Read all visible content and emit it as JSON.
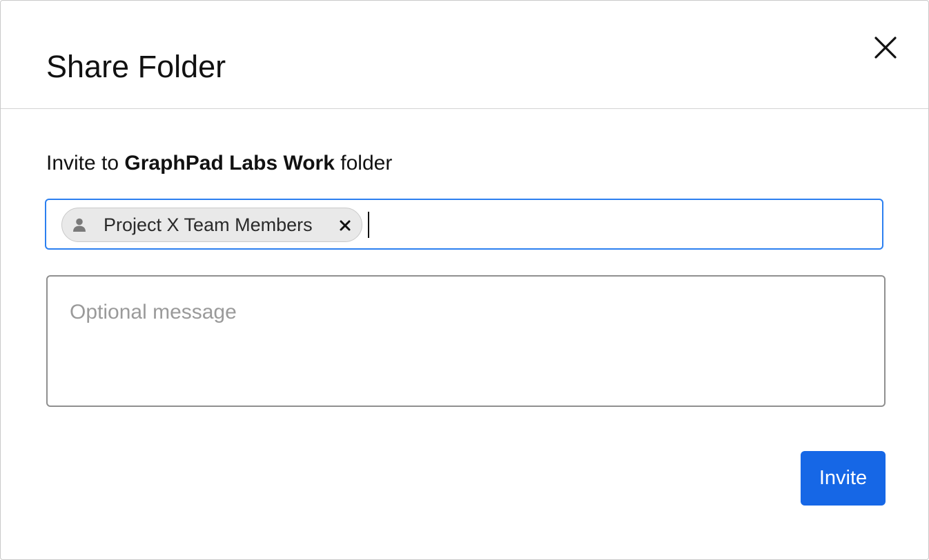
{
  "dialog": {
    "title": "Share Folder",
    "close_icon": "close-icon"
  },
  "invite": {
    "prefix": "Invite to",
    "folder_name": "GraphPad Labs Work",
    "suffix": "folder"
  },
  "recipients": {
    "chips": [
      {
        "label": "Project X Team Members",
        "icon": "person-icon",
        "remove_icon": "remove-icon"
      }
    ]
  },
  "message": {
    "placeholder": "Optional message",
    "value": ""
  },
  "actions": {
    "invite_label": "Invite"
  },
  "colors": {
    "accent": "#1667e6",
    "focus_border": "#2b7ff0",
    "chip_background": "#e9e9e9"
  }
}
